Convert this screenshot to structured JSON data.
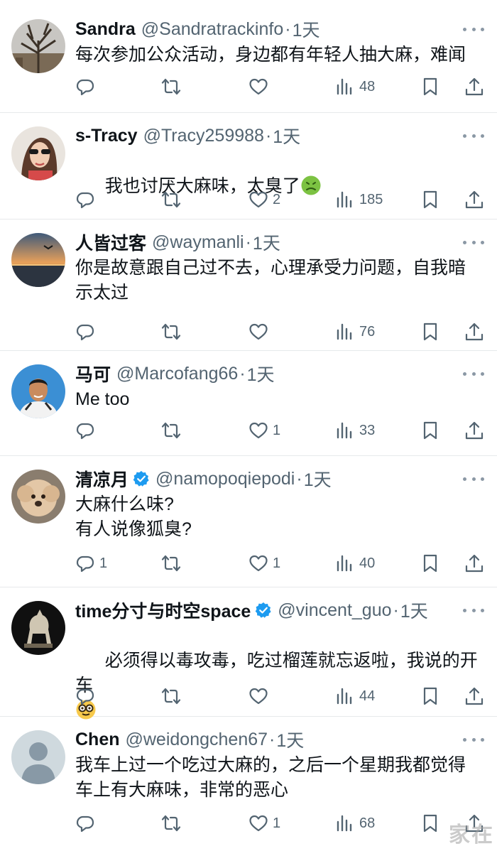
{
  "tweets": [
    {
      "name": "Sandra",
      "handle": "@Sandratrackinfo",
      "dot": "·",
      "time": "1天",
      "verified": false,
      "text": "每次参加公众活动，身边都有年轻人抽大麻，难闻",
      "likes": "",
      "views": "48",
      "replies": "",
      "avatar": "tree-photo"
    },
    {
      "name": "s-Tracy",
      "handle": "@Tracy259988",
      "dot": "·",
      "time": "1天",
      "verified": false,
      "text": "我也讨厌大麻味，太臭了",
      "emoji": "nauseated-face",
      "likes": "2",
      "views": "185",
      "replies": "",
      "avatar": "woman-sunglasses-photo"
    },
    {
      "name": "人皆过客",
      "handle": "@waymanli",
      "dot": "·",
      "time": "1天",
      "verified": false,
      "text": "你是故意跟自己过不去，心理承受力问题，自我暗\n示太过",
      "likes": "",
      "views": "76",
      "replies": "",
      "avatar": "sunset-sea-photo"
    },
    {
      "name": "马可",
      "handle": "@Marcofang66",
      "dot": "·",
      "time": "1天",
      "verified": false,
      "text": "Me too",
      "likes": "1",
      "views": "33",
      "replies": "",
      "avatar": "man-portrait-photo"
    },
    {
      "name": "清凉月",
      "handle": "@namopoqiepodi",
      "dot": "·",
      "time": "1天",
      "verified": true,
      "text": "大麻什么味?\n有人说像狐臭?",
      "likes": "1",
      "views": "40",
      "replies": "1",
      "avatar": "dog-photo"
    },
    {
      "name": "time分寸与时空space",
      "handle": "@vincent_guo",
      "dot": "·",
      "time": "1天",
      "verified": true,
      "text": "必须得以毒攻毒，吃过榴莲就忘返啦，我说的开车",
      "emoji": "nerd-face",
      "likes": "",
      "views": "44",
      "replies": "",
      "avatar": "horse-statue-photo"
    },
    {
      "name": "Chen",
      "handle": "@weidongchen67",
      "dot": "·",
      "time": "1天",
      "verified": false,
      "text": "我车上过一个吃过大麻的，之后一个星期我都觉得\n车上有大麻味，非常的恶心",
      "likes": "1",
      "views": "68",
      "replies": "",
      "avatar": "default-profile"
    }
  ],
  "icons": {
    "reply": "reply-icon",
    "retweet": "retweet-icon",
    "like": "heart-icon",
    "views": "views-icon",
    "bookmark": "bookmark-icon",
    "share": "share-icon",
    "more": "more-icon",
    "verified": "verified-badge-icon"
  },
  "colors": {
    "text": "#0f1419",
    "secondary": "#536471",
    "verified": "#1d9bf0",
    "divider": "#e6e9eb"
  },
  "watermark": "家在"
}
